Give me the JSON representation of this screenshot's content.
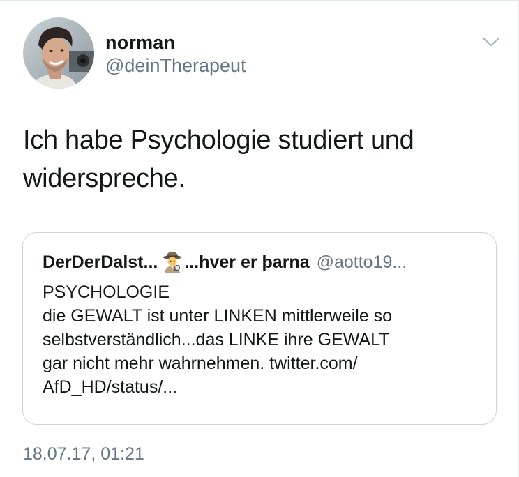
{
  "tweet": {
    "author": {
      "name": "norman",
      "handle": "@deinTherapeut",
      "avatar_icon": "profile-photo"
    },
    "text_lines": [
      "Ich habe Psychologie studiert und",
      "widerspreche."
    ],
    "menu_icon": "chevron-down-icon",
    "timestamp": "18.07.17, 01:21"
  },
  "quoted_tweet": {
    "name_part1": "DerDerDalst...",
    "emoji_icon": "detective-emoji",
    "name_part2": "...hver er þarna",
    "handle": "@aotto19...",
    "body_lines": [
      "PSYCHOLOGIE",
      "die GEWALT ist unter LINKEN mittlerweile so",
      "selbstverständlich...das LINKE ihre GEWALT",
      "gar nicht mehr wahrnehmen. twitter.com/",
      "AfD_HD/status/..."
    ]
  },
  "colors": {
    "text_primary": "#14171a",
    "text_secondary": "#657786",
    "border": "#ccd6dd",
    "chevron": "#aab8c2"
  }
}
